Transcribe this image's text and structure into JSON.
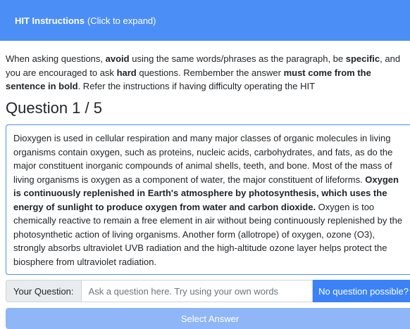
{
  "banner": {
    "title": "HIT Instructions",
    "hint": "(Click to expand)"
  },
  "intro": {
    "p1": "When asking questions, ",
    "b1": "avoid",
    "p2": " using the same words/phrases as the paragraph, be ",
    "b2": "specific",
    "p3": ", and you are encouraged to ask ",
    "b3": "hard",
    "p4": " questions. Rembember the answer ",
    "b4": "must come from the sentence in bold",
    "p5": ". Refer the instructions if having difficulty operating the HIT"
  },
  "question": {
    "title": "Question 1 / 5"
  },
  "paragraph": {
    "before": "Dioxygen is used in cellular respiration and many major classes of organic molecules in living organisms contain oxygen, such as proteins, nucleic acids, carbohydrates, and fats, as do the major constituent inorganic compounds of animal shells, teeth, and bone. Most of the mass of living organisms is oxygen as a component of water, the major constituent of lifeforms. ",
    "bold": "Oxygen is continuously replenished in Earth's atmosphere by photosynthesis, which uses the energy of sunlight to produce oxygen from water and carbon dioxide.",
    "after": " Oxygen is too chemically reactive to remain a free element in air without being continuously replenished by the photosynthetic action of living organisms. Another form (allotrope) of oxygen, ozone (O3), strongly absorbs ultraviolet UVB radiation and the high-altitude ozone layer helps protect the biosphere from ultraviolet radiation."
  },
  "form": {
    "label": "Your Question:",
    "placeholder": "Ask a question here. Try using your own words",
    "no_question": "No question possible?",
    "select": "Select Answer"
  }
}
